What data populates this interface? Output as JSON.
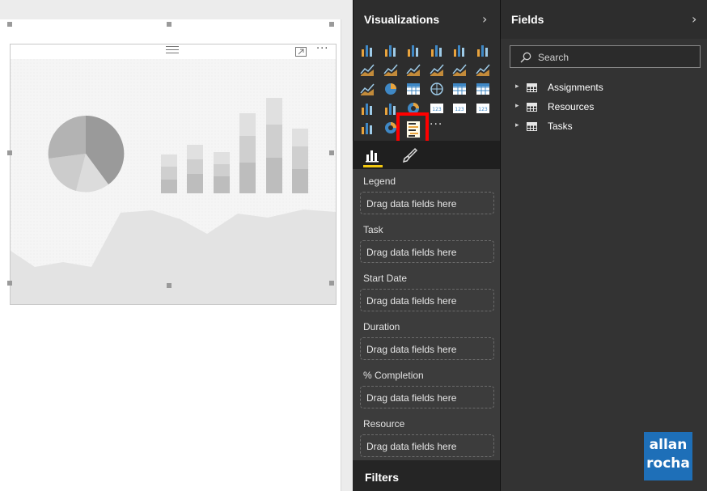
{
  "visualizations": {
    "title": "Visualizations",
    "more_label": "···"
  },
  "wells": [
    {
      "label": "Legend",
      "placeholder": "Drag data fields here"
    },
    {
      "label": "Task",
      "placeholder": "Drag data fields here"
    },
    {
      "label": "Start Date",
      "placeholder": "Drag data fields here"
    },
    {
      "label": "Duration",
      "placeholder": "Drag data fields here"
    },
    {
      "label": "% Completion",
      "placeholder": "Drag data fields here"
    },
    {
      "label": "Resource",
      "placeholder": "Drag data fields here"
    }
  ],
  "filters": {
    "title": "Filters"
  },
  "fields": {
    "title": "Fields",
    "search_placeholder": "Search",
    "tables": [
      "Assignments",
      "Resources",
      "Tasks"
    ]
  },
  "visual": {
    "more_label": "···"
  },
  "logo": {
    "line1": "allan",
    "line2": "rocha"
  },
  "colors": {
    "accent": "#f2c811",
    "highlight": "#ff0000",
    "viz_bg": "#2d2d2d",
    "wells_bg": "#3c3c3c"
  }
}
